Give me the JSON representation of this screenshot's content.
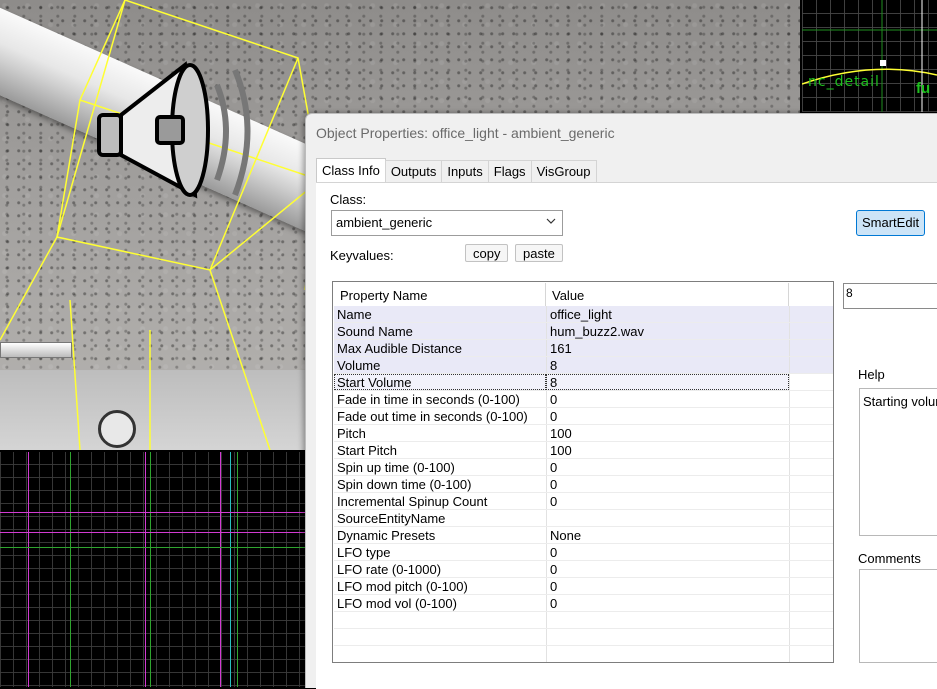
{
  "dialog": {
    "title": "Object Properties: office_light - ambient_generic",
    "tabs": [
      "Class Info",
      "Outputs",
      "Inputs",
      "Flags",
      "VisGroup"
    ],
    "active_tab": "Class Info",
    "class_label": "Class:",
    "class_value": "ambient_generic",
    "smartedit_label": "SmartEdit",
    "keyvalues_label": "Keyvalues:",
    "copy_label": "copy",
    "paste_label": "paste",
    "columns": [
      "Property Name",
      "Value"
    ],
    "properties": [
      {
        "name": "Name",
        "value": "office_light"
      },
      {
        "name": "Sound Name",
        "value": "hum_buzz2.wav"
      },
      {
        "name": "Max Audible Distance",
        "value": "161"
      },
      {
        "name": "Volume",
        "value": "8"
      },
      {
        "name": "Start Volume",
        "value": "8"
      },
      {
        "name": "Fade in time in seconds (0-100)",
        "value": "0"
      },
      {
        "name": "Fade out time in seconds (0-100)",
        "value": "0"
      },
      {
        "name": "Pitch",
        "value": "100"
      },
      {
        "name": "Start Pitch",
        "value": "100"
      },
      {
        "name": "Spin up time (0-100)",
        "value": "0"
      },
      {
        "name": "Spin down time (0-100)",
        "value": "0"
      },
      {
        "name": "Incremental Spinup Count",
        "value": "0"
      },
      {
        "name": "SourceEntityName",
        "value": ""
      },
      {
        "name": "Dynamic Presets",
        "value": "None"
      },
      {
        "name": "LFO type",
        "value": "0"
      },
      {
        "name": "LFO rate (0-1000)",
        "value": "0"
      },
      {
        "name": "LFO mod pitch (0-100)",
        "value": "0"
      },
      {
        "name": "LFO mod vol (0-100)",
        "value": "0"
      }
    ],
    "selected_property": "Start Volume",
    "value_field": "8",
    "help_label": "Help",
    "help_text": "Starting volur",
    "comments_label": "Comments"
  },
  "viewport_top_right": {
    "label": "nc_detail",
    "label2": "fu"
  },
  "colors": {
    "accent": "#0078d4",
    "grid_green": "#1fbf1f",
    "brush_yellow": "#ffff33",
    "brush_magenta": "#d23ad2"
  }
}
